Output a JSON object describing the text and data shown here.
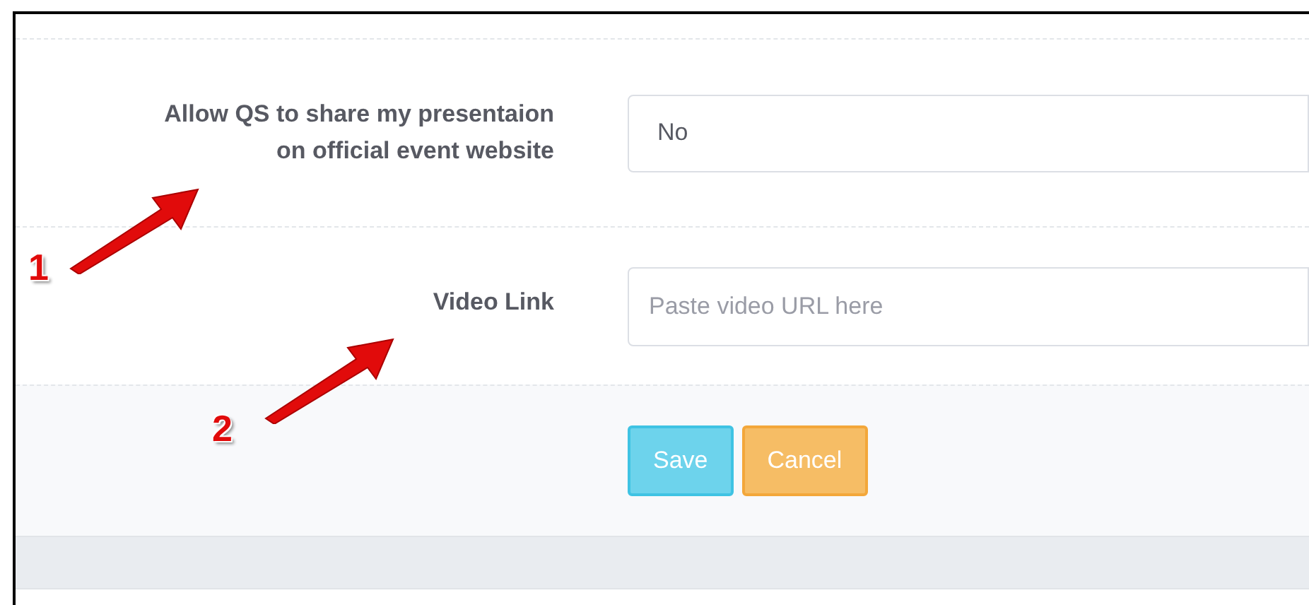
{
  "fields": [
    {
      "kind": "select",
      "label": "Allow QS to share my presentaion on official event website",
      "value": "No"
    },
    {
      "kind": "text",
      "label": "Video Link",
      "placeholder": "Paste video URL here"
    }
  ],
  "buttons": [
    {
      "kind": "primary",
      "label": "Save"
    },
    {
      "kind": "warning",
      "label": "Cancel"
    }
  ],
  "annotations": [
    {
      "number": "1"
    },
    {
      "number": "2"
    }
  ]
}
